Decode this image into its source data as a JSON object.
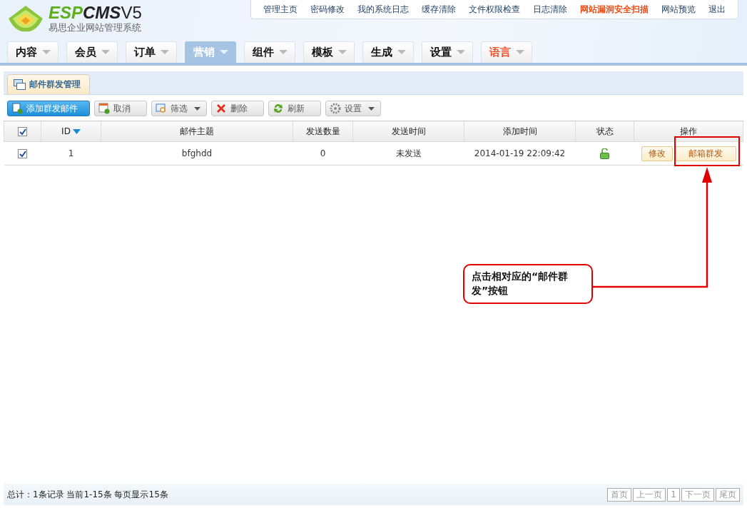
{
  "logo": {
    "parts": [
      {
        "text": "ESP",
        "kind": "accent"
      },
      {
        "text": "CMS",
        "kind": "plain"
      },
      {
        "text": "V5",
        "kind": "version"
      }
    ],
    "subtitle": "易思企业网站管理系统"
  },
  "top_links": [
    {
      "label": "管理主页",
      "highlighted": false
    },
    {
      "label": "密码修改",
      "highlighted": false
    },
    {
      "label": "我的系统日志",
      "highlighted": false
    },
    {
      "label": "缓存清除",
      "highlighted": false
    },
    {
      "label": "文件权限检查",
      "highlighted": false
    },
    {
      "label": "日志清除",
      "highlighted": false
    },
    {
      "label": "网站漏洞安全扫描",
      "highlighted": true
    },
    {
      "label": "网站预览",
      "highlighted": false
    },
    {
      "label": "退出",
      "highlighted": false
    }
  ],
  "nav_tabs": [
    {
      "label": "内容",
      "selected": false,
      "highlighted": false
    },
    {
      "label": "会员",
      "selected": false,
      "highlighted": false
    },
    {
      "label": "订单",
      "selected": false,
      "highlighted": false
    },
    {
      "label": "营销",
      "selected": true,
      "highlighted": false
    },
    {
      "label": "组件",
      "selected": false,
      "highlighted": false
    },
    {
      "label": "模板",
      "selected": false,
      "highlighted": false
    },
    {
      "label": "生成",
      "selected": false,
      "highlighted": false
    },
    {
      "label": "设置",
      "selected": false,
      "highlighted": false
    },
    {
      "label": "语言",
      "selected": false,
      "highlighted": true
    }
  ],
  "page_tab": {
    "label": "邮件群发管理"
  },
  "toolbar": [
    {
      "label": "添加群发邮件",
      "kind": "add",
      "primary": true,
      "dropdown": false
    },
    {
      "label": "取消",
      "kind": "cancel",
      "primary": false,
      "dropdown": false
    },
    {
      "label": "筛选",
      "kind": "filter",
      "primary": false,
      "dropdown": true
    },
    {
      "label": "删除",
      "kind": "delete",
      "primary": false,
      "dropdown": false
    },
    {
      "label": "刷新",
      "kind": "refresh",
      "primary": false,
      "dropdown": false
    },
    {
      "label": "设置",
      "kind": "settings",
      "primary": false,
      "dropdown": true
    }
  ],
  "table": {
    "header_checked": true,
    "columns": [
      {
        "label": "ID",
        "sorted": true
      },
      {
        "label": "邮件主题",
        "sorted": false
      },
      {
        "label": "发送数量",
        "sorted": false
      },
      {
        "label": "发送时间",
        "sorted": false
      },
      {
        "label": "添加时间",
        "sorted": false
      },
      {
        "label": "状态",
        "sorted": false
      },
      {
        "label": "操作",
        "sorted": false
      }
    ],
    "rows": [
      {
        "checked": true,
        "id": "1",
        "subject": "bfghdd",
        "count": "0",
        "send_time": "未发送",
        "add_time": "2014-01-19 22:09:42",
        "unlocked": true,
        "actions": [
          "修改",
          "邮箱群发"
        ]
      }
    ]
  },
  "annotation": {
    "text": "点击相对应的“邮件群发”按钮"
  },
  "footer": {
    "summary": "总计：1条记录 当前1-15条 每页显示15条",
    "pager": [
      "首页",
      "上一页",
      "1",
      "下一页",
      "尾页"
    ]
  }
}
